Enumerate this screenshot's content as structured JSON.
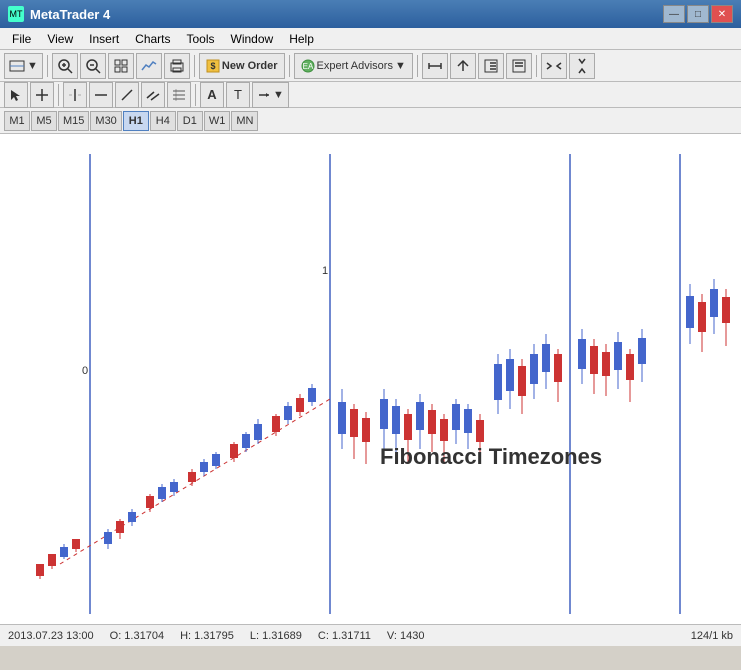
{
  "titleBar": {
    "title": "MetaTrader 4",
    "minBtn": "—",
    "maxBtn": "□",
    "closeBtn": "✕"
  },
  "menuBar": {
    "items": [
      "File",
      "View",
      "Insert",
      "Charts",
      "Tools",
      "Window",
      "Help"
    ]
  },
  "toolbar1": {
    "newOrderLabel": "New Order",
    "expertAdvisorsLabel": "Expert Advisors"
  },
  "timeframes": {
    "items": [
      "M1",
      "M5",
      "M15",
      "M30",
      "H1",
      "H4",
      "D1",
      "W1",
      "MN"
    ],
    "active": "H1"
  },
  "chart": {
    "fibLabel": "Fibonacci Timezones",
    "line0Label": "0",
    "line1Label": "1"
  },
  "statusBar": {
    "datetime": "2013.07.23 13:00",
    "open": "O: 1.31704",
    "high": "H: 1.31795",
    "low": "L: 1.31689",
    "close": "C: 1.31711",
    "volume": "V: 1430",
    "info": "124/1 kb"
  }
}
